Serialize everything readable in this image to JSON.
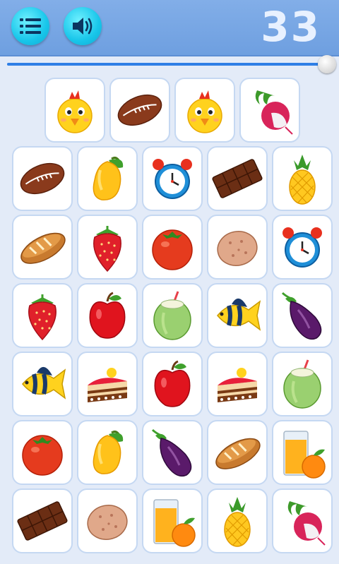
{
  "header": {
    "score": "33",
    "menu_icon": "menu-list-icon",
    "sound_icon": "speaker-icon"
  },
  "timer": {
    "progress": 1.0
  },
  "colors": {
    "bar": "#7aa8e6",
    "tile_border": "#c5d8f2",
    "background": "#e3ebf8",
    "button": "#18c6ea"
  },
  "board": {
    "rows": [
      [
        "chick",
        "football",
        "chick",
        "radish"
      ],
      [
        "football",
        "mango",
        "alarm-clock",
        "chocolate",
        "pineapple"
      ],
      [
        "bread",
        "strawberry",
        "tomato",
        "potato",
        "alarm-clock"
      ],
      [
        "strawberry",
        "apple",
        "coconut",
        "fish",
        "eggplant"
      ],
      [
        "fish",
        "cake",
        "apple",
        "cake",
        "coconut"
      ],
      [
        "tomato",
        "mango",
        "eggplant",
        "bread",
        "juice"
      ],
      [
        "chocolate",
        "potato",
        "juice",
        "pineapple",
        "radish"
      ]
    ]
  }
}
